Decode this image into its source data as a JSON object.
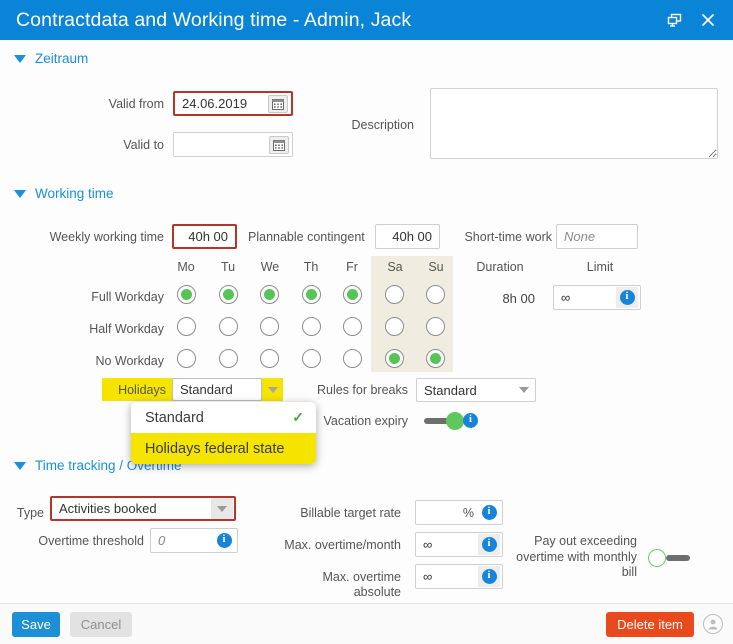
{
  "window": {
    "title": "Contractdata and Working time - Admin, Jack",
    "restore_icon": "window-restore-icon",
    "close_icon": "close-icon",
    "accent_color": "#0a84d6"
  },
  "sections": {
    "zeitraum": {
      "title": "Zeitraum"
    },
    "working_time": {
      "title": "Working time"
    },
    "time_tracking": {
      "title": "Time tracking / Overtime"
    }
  },
  "zeitraum": {
    "valid_from_label": "Valid from",
    "valid_from_value": "24.06.2019",
    "valid_to_label": "Valid to",
    "valid_to_value": "",
    "calendar_icon": "calendar-icon",
    "description_label": "Description",
    "description_value": "",
    "required_border_color": "#b5352b"
  },
  "working_time": {
    "weekly_label": "Weekly working time",
    "weekly_value": "40h 00",
    "plannable_label": "Plannable contingent",
    "plannable_value": "40h 00",
    "shorttime_label": "Short-time work",
    "shorttime_placeholder": "None",
    "shorttime_value": "",
    "days": [
      "Mo",
      "Tu",
      "We",
      "Th",
      "Fr",
      "Sa",
      "Su"
    ],
    "weekend_days": [
      "Sa",
      "Su"
    ],
    "weekend_shade_color": "#f0ece0",
    "rows": [
      {
        "label": "Full Workday",
        "selected": [
          true,
          true,
          true,
          true,
          true,
          false,
          false
        ]
      },
      {
        "label": "Half Workday",
        "selected": [
          false,
          false,
          false,
          false,
          false,
          false,
          false
        ]
      },
      {
        "label": "No Workday",
        "selected": [
          false,
          false,
          false,
          false,
          false,
          true,
          true
        ]
      }
    ],
    "duration_label": "Duration",
    "duration_value": "8h 00",
    "limit_label": "Limit",
    "limit_value": "∞",
    "info_icon": "info-icon",
    "holidays_label": "Holidays",
    "holidays_value": "Standard",
    "holidays_options": [
      {
        "label": "Standard",
        "checked": true,
        "highlighted": false
      },
      {
        "label": "Holidays federal state",
        "checked": false,
        "highlighted": true
      }
    ],
    "holidays_highlight_color": "#f5e400",
    "breaks_label": "Rules for breaks",
    "breaks_value": "Standard",
    "vacation_expiry_label": "Vacation expiry",
    "vacation_expiry_on": true
  },
  "time_tracking": {
    "type_label": "Type",
    "type_value": "Activities booked",
    "overtime_threshold_label": "Overtime threshold",
    "overtime_threshold_placeholder": "0",
    "billable_label": "Billable target rate",
    "billable_value": "",
    "billable_suffix": "%",
    "max_month_label": "Max. overtime/month",
    "max_month_value": "∞",
    "max_abs_label": "Max. overtime absolute",
    "max_abs_value": "∞",
    "payout_label_line1": "Pay out exceeding",
    "payout_label_line2": "overtime with monthly",
    "payout_label_line3": "bill",
    "payout_on": false
  },
  "footer": {
    "save_label": "Save",
    "cancel_label": "Cancel",
    "delete_label": "Delete item",
    "avatar_icon": "user-avatar-icon",
    "save_color": "#1d8fd6",
    "delete_color": "#e8491d"
  }
}
